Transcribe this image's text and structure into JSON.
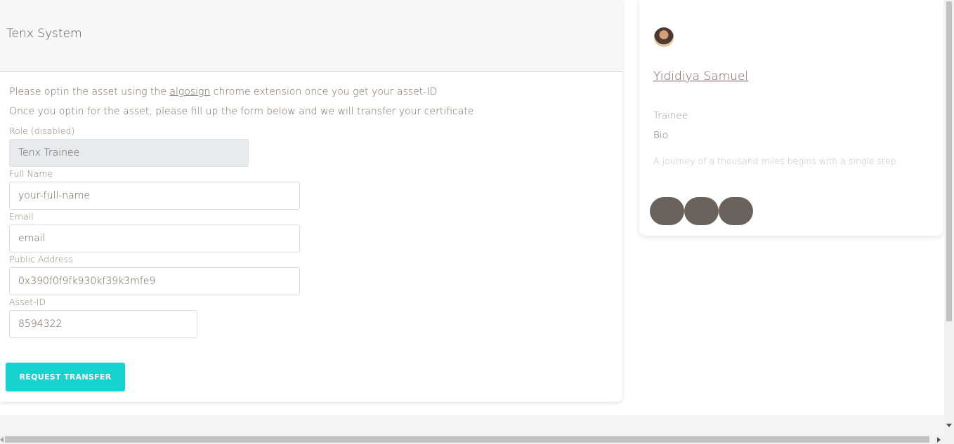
{
  "header": {
    "title": "Tenx System"
  },
  "instructions": {
    "line1_before": "Please optin the asset using the ",
    "line1_link": "algosign",
    "line1_after": " chrome extension once you get your asset-ID",
    "line2": "Once you optin for the asset, please fill up the form below and we will transfer your certificate"
  },
  "form": {
    "role": {
      "label": "Role (disabled)",
      "value": "Tenx Trainee"
    },
    "full_name": {
      "label": "Full Name",
      "placeholder": "your-full-name"
    },
    "email": {
      "label": "Email",
      "placeholder": "email"
    },
    "public_address": {
      "label": "Public Address",
      "value": "0x390f0f9fk930kf39k3mfe9"
    },
    "asset_id": {
      "label": "Asset-ID",
      "value": "8594322"
    },
    "submit_label": "REQUEST TRANSFER"
  },
  "profile": {
    "name": "Yididiya Samuel",
    "role": "Trainee",
    "bio_label": "Bio",
    "bio": "A journey of a thousand miles begins with a single step.",
    "social_icons": [
      "social-icon-1",
      "social-icon-2",
      "social-icon-3"
    ]
  },
  "colors": {
    "accent": "#17d2cf",
    "social_button": "#6a625d"
  }
}
